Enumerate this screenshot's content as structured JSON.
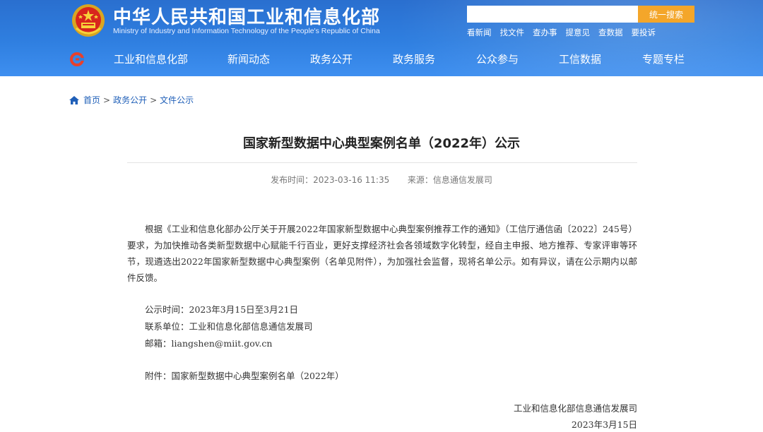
{
  "header": {
    "site_title_cn": "中华人民共和国工业和信息化部",
    "site_title_en": "Ministry of Industry and Information Technology of the People's Republic of China",
    "search": {
      "placeholder": "",
      "button_label": "统一搜索"
    },
    "quick_links": [
      "看新闻",
      "找文件",
      "查办事",
      "提意见",
      "查数据",
      "要投诉"
    ],
    "nav": [
      "工业和信息化部",
      "新闻动态",
      "政务公开",
      "政务服务",
      "公众参与",
      "工信数据",
      "专题专栏"
    ],
    "colors": {
      "header_blue": "#2f7fe0",
      "search_button": "#f4a62a"
    }
  },
  "breadcrumb": [
    "首页",
    "政务公开",
    "文件公示"
  ],
  "article": {
    "title": "国家新型数据中心典型案例名单（2022年）公示",
    "meta": {
      "published_label": "发布时间：",
      "published": "2023-03-16 11:35",
      "source_label": "来源：",
      "source": "信息通信发展司"
    },
    "paragraph1": "根据《工业和信息化部办公厅关于开展2022年国家新型数据中心典型案例推荐工作的通知》（工信厅通信函〔2022〕245号）要求，为加快推动各类新型数据中心赋能千行百业，更好支撑经济社会各领域数字化转型，经自主申报、地方推荐、专家评审等环节，现遴选出2022年国家新型数据中心典型案例（名单见附件），为加强社会监督，现将名单公示。如有异议，请在公示期内以邮件反馈。",
    "notice_period": "公示时间：2023年3月15日至3月21日",
    "contact": "联系单位：工业和信息化部信息通信发展司",
    "email": "邮箱：liangshen@miit.gov.cn",
    "attachment": "附件：国家新型数据中心典型案例名单（2022年）",
    "signature_org": "工业和信息化部信息通信发展司",
    "signature_date": "2023年3月15日"
  }
}
